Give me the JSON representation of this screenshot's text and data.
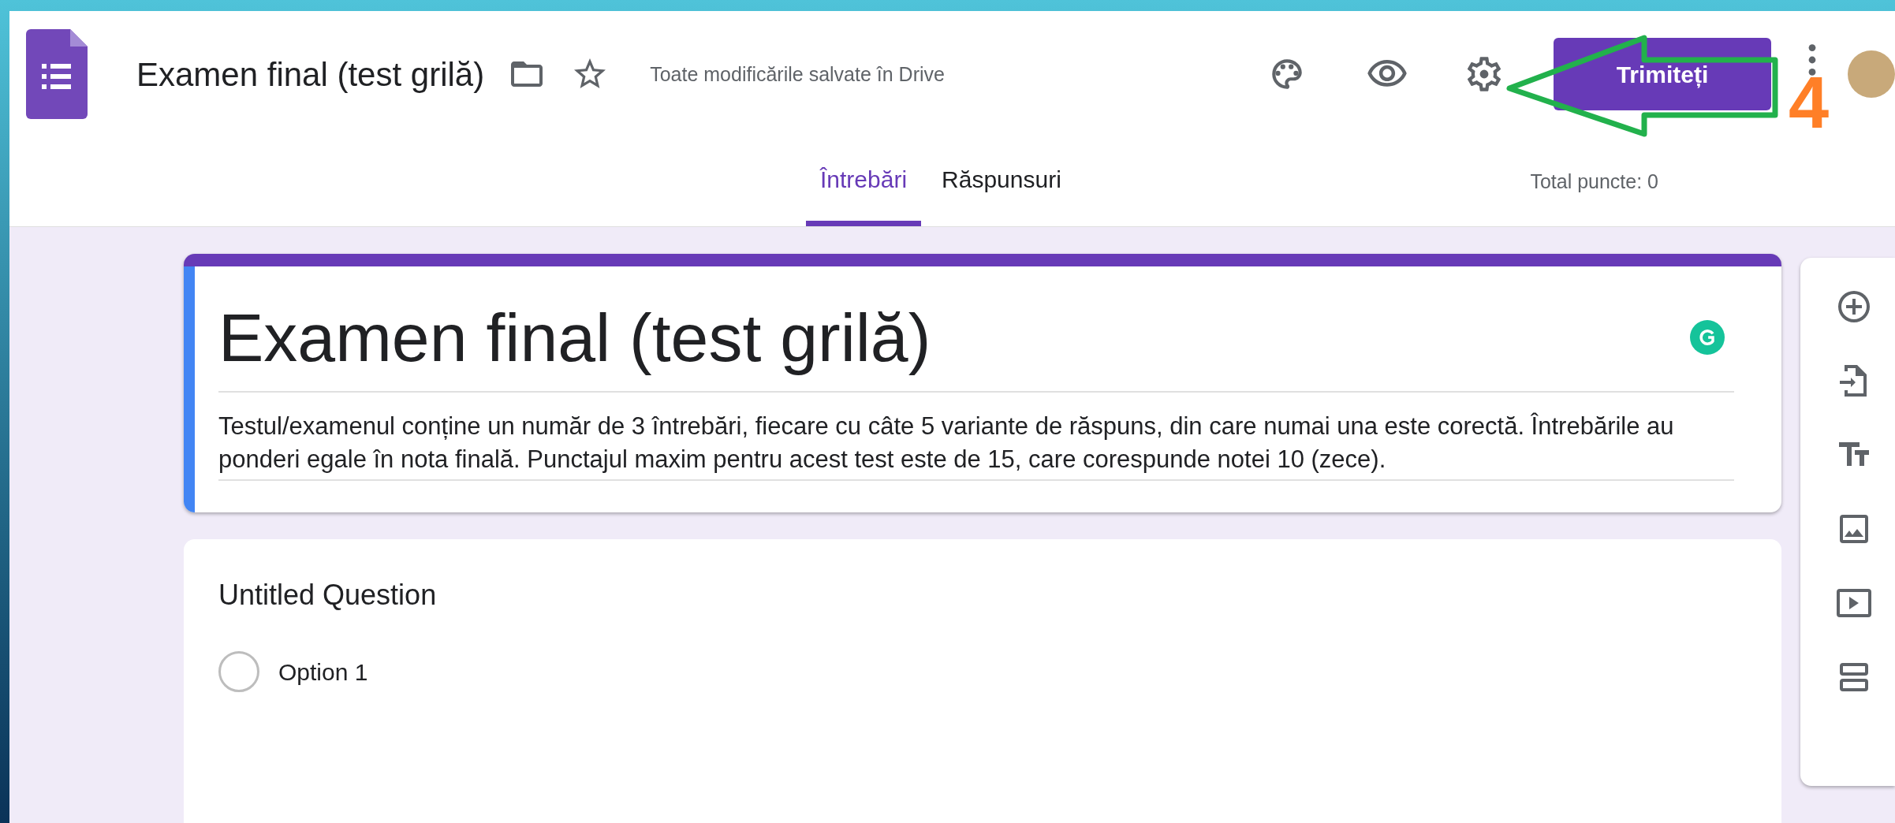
{
  "header": {
    "app_title": "Examen final (test grilă)",
    "save_status": "Toate modificările salvate în Drive",
    "send_button": "Trimiteți"
  },
  "tabs": [
    {
      "label": "Întrebări",
      "selected": true
    },
    {
      "label": "Răspunsuri",
      "selected": false
    }
  ],
  "total_points": "Total puncte: 0",
  "form": {
    "title": "Examen final (test grilă)",
    "description": "Testul/examenul conține un număr de 3 întrebări, fiecare cu câte 5 variante de răspuns, din care numai una este corectă. Întrebările au ponderi egale în nota finală. Punctajul maxim pentru acest test este de 15, care corespunde notei 10 (zece)."
  },
  "question": {
    "title": "Untitled Question",
    "options": [
      {
        "label": "Option 1",
        "selected": false
      }
    ]
  },
  "annotation": {
    "step": "4"
  }
}
